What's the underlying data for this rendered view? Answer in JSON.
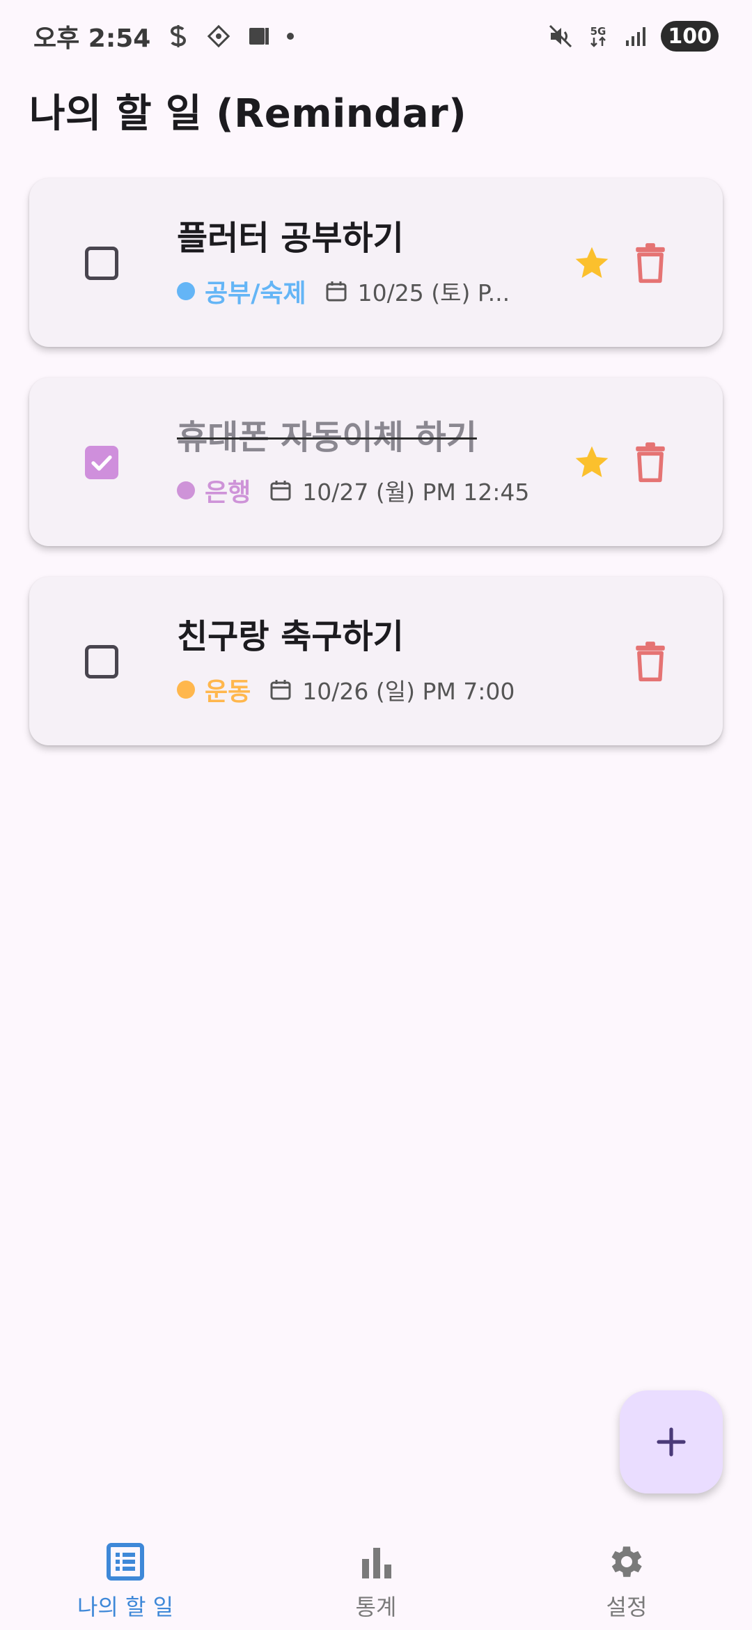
{
  "status_bar": {
    "time": "오후 2:54",
    "network": "5G",
    "battery": "100",
    "icons": [
      "dollar-icon",
      "diamond-app-icon",
      "cast-icon",
      "notification-dot",
      "mute-icon",
      "5g-icon",
      "signal-icon",
      "battery-icon"
    ]
  },
  "app": {
    "title": "나의 할 일 (Remindar)"
  },
  "tasks": [
    {
      "title": "플러터 공부하기",
      "completed": false,
      "category": "공부/숙제",
      "category_color": "#64b5f6",
      "date": "10/25 (토) P...",
      "starred": true
    },
    {
      "title": "휴대폰 자동이체 하기",
      "completed": true,
      "category": "은행",
      "category_color": "#ce93d8",
      "date": "10/27 (월) PM 12:45",
      "starred": true
    },
    {
      "title": "친구랑 축구하기",
      "completed": false,
      "category": "운동",
      "category_color": "#ffb74d",
      "date": "10/26 (일) PM 7:00",
      "starred": false
    }
  ],
  "fab": {
    "icon": "plus-icon"
  },
  "bottom_nav": {
    "items": [
      {
        "label": "나의 할 일",
        "icon": "list-icon",
        "active": true
      },
      {
        "label": "통계",
        "icon": "bar-chart-icon",
        "active": false
      },
      {
        "label": "설정",
        "icon": "gear-icon",
        "active": false
      }
    ]
  },
  "colors": {
    "background": "#fdf7fd",
    "card": "#f6f1f7",
    "star": "#fbc02d",
    "trash": "#e57373",
    "active_nav": "#3e88d8",
    "fab": "#eaddff"
  }
}
